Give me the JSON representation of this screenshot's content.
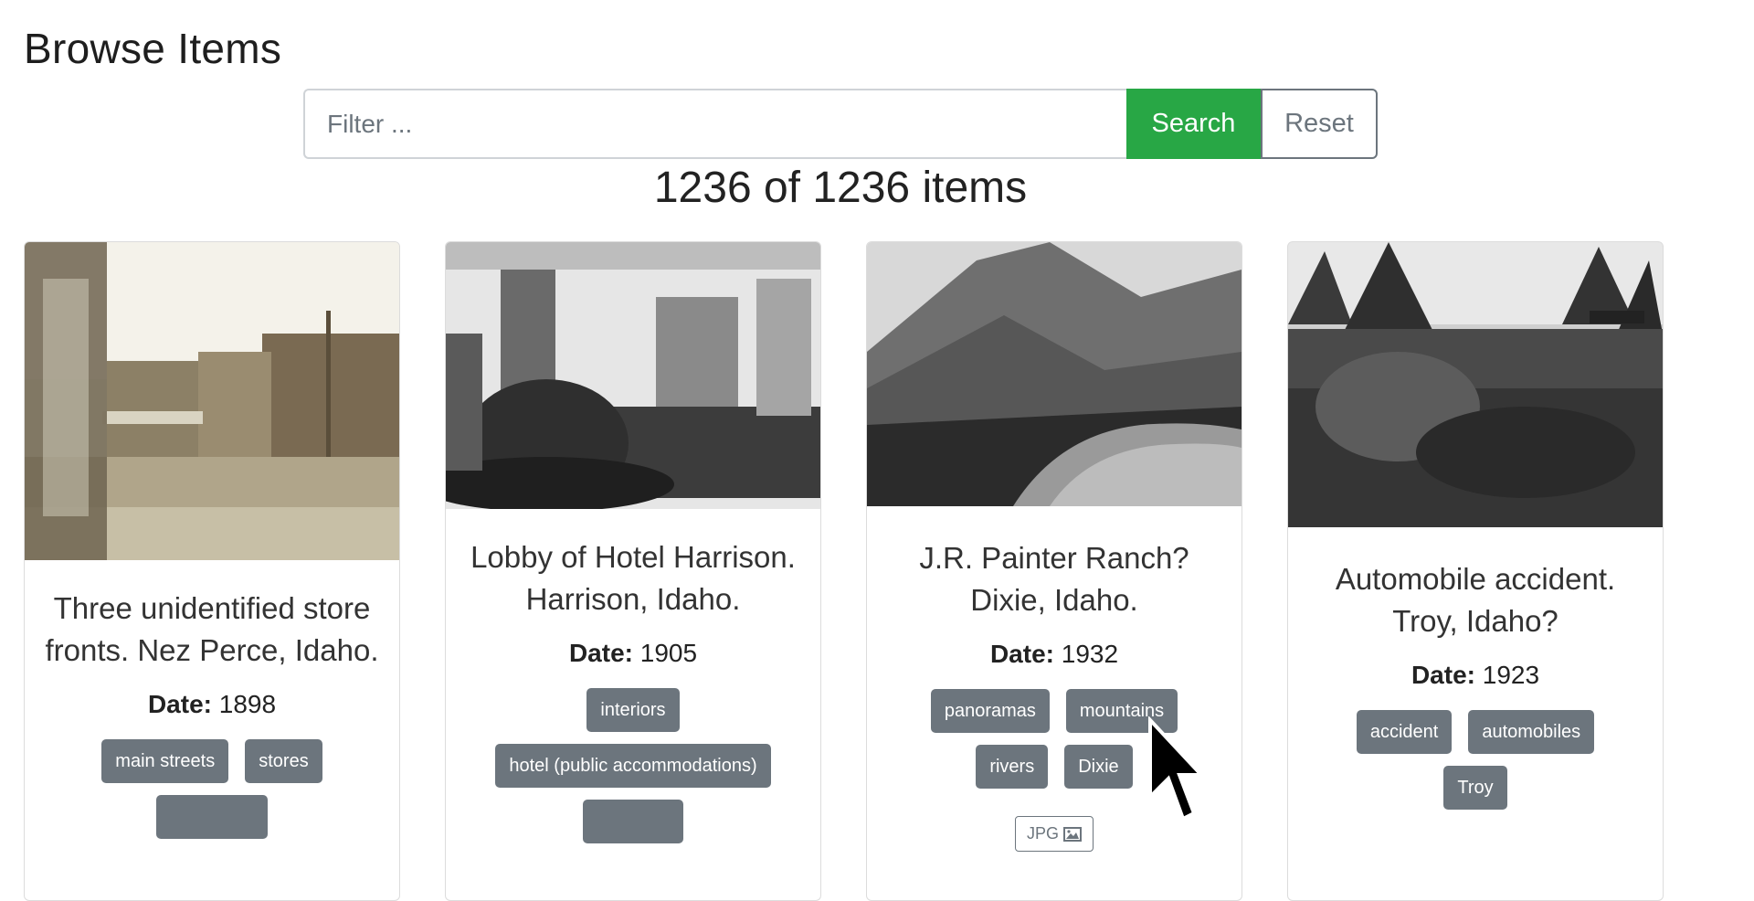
{
  "page": {
    "title": "Browse Items"
  },
  "search": {
    "placeholder": "Filter ...",
    "search_label": "Search",
    "reset_label": "Reset"
  },
  "results": {
    "count_text": "1236 of 1236 items"
  },
  "items": [
    {
      "title": "Three unidentified store fronts. Nez Perce, Idaho.",
      "date_label": "Date:",
      "date": "1898",
      "tags": [
        "main streets",
        "stores",
        ""
      ]
    },
    {
      "title": "Lobby of Hotel Harrison. Harrison, Idaho.",
      "date_label": "Date:",
      "date": "1905",
      "tags": [
        "interiors",
        "hotel (public accommodations)",
        ""
      ]
    },
    {
      "title": "J.R. Painter Ranch? Dixie, Idaho.",
      "date_label": "Date:",
      "date": "1932",
      "tags": [
        "panoramas",
        "mountains",
        "rivers",
        "Dixie"
      ],
      "format": "JPG"
    },
    {
      "title": "Automobile accident. Troy, Idaho?",
      "date_label": "Date:",
      "date": "1923",
      "tags": [
        "accident",
        "automobiles",
        "Troy"
      ]
    }
  ],
  "colors": {
    "search_button": "#28a745",
    "tag_bg": "#6c757d",
    "reset_border": "#6c757d"
  },
  "icons": {
    "format_icon": "image-icon",
    "cursor": "mouse-pointer-icon"
  }
}
